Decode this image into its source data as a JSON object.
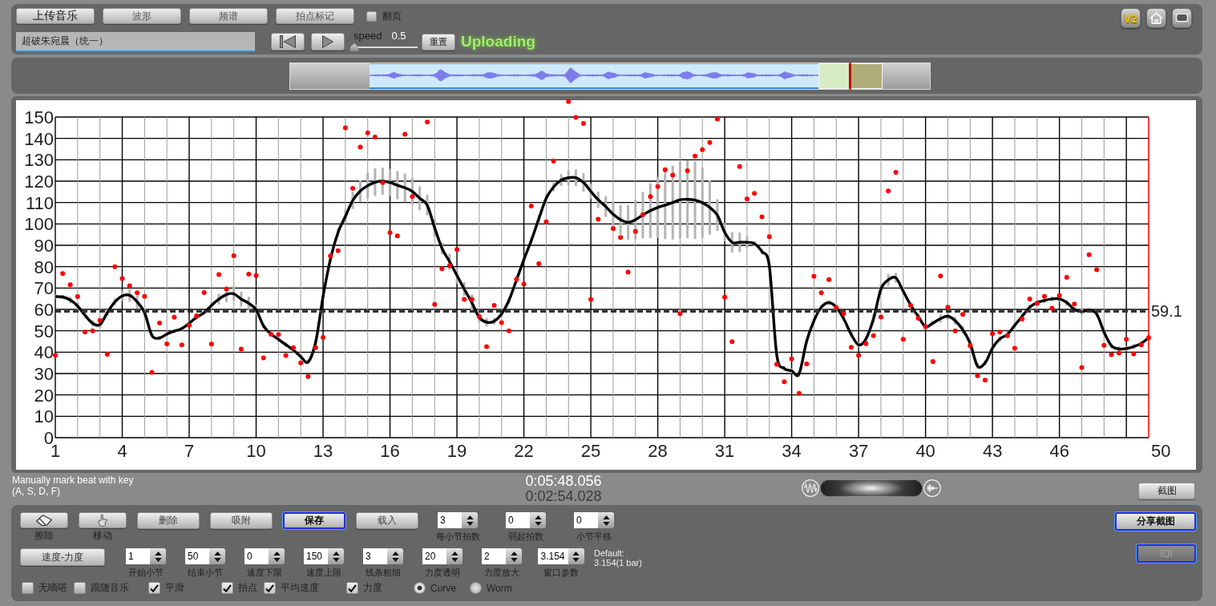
{
  "toolbar": {
    "buttons": [
      {
        "label": "上传音乐",
        "kind": "primary"
      },
      {
        "label": "波形",
        "kind": "view"
      },
      {
        "label": "频谱",
        "kind": "view"
      },
      {
        "label": "拍点标记",
        "kind": "view"
      }
    ],
    "page_turn": {
      "label": "翻页",
      "checked": false
    },
    "version_badge": "V2"
  },
  "player": {
    "track_title": "超破朱宛晨（统一）",
    "speed": {
      "label": "speed",
      "value": "0.5",
      "level": 0
    },
    "reset_button": "重置",
    "status": "Uploading"
  },
  "chart": {
    "chart_data": {
      "type": "scatter",
      "x": [
        1,
        1.33,
        1.67,
        2,
        2.33,
        2.67,
        3,
        3.33,
        3.67,
        4,
        4.33,
        4.67,
        5,
        5.33,
        5.67,
        6,
        6.33,
        6.67,
        7,
        7.33,
        7.67,
        8,
        8.33,
        8.67,
        9,
        9.33,
        9.67,
        10,
        10.33,
        10.67,
        11,
        11.33,
        11.67,
        12,
        12.33,
        12.67,
        13,
        13.33,
        13.67,
        14,
        14.33,
        14.67,
        15,
        15.33,
        15.67,
        16,
        16.33,
        16.67,
        17,
        17.33,
        17.67,
        18,
        18.33,
        18.67,
        19,
        19.33,
        19.67,
        20,
        20.33,
        20.67,
        21,
        21.33,
        21.67,
        22,
        22.33,
        22.67,
        23,
        23.33,
        23.67,
        24,
        24.33,
        24.67,
        25,
        25.33,
        25.67,
        26,
        26.33,
        26.67,
        27,
        27.33,
        27.67,
        28,
        28.33,
        28.67,
        29,
        29.33,
        29.67,
        30,
        30.33,
        30.67,
        31,
        31.33,
        31.67,
        32,
        32.33,
        32.67,
        33,
        33.33,
        33.67,
        34,
        34.33,
        34.67,
        35,
        35.33,
        35.67,
        36,
        36.33,
        36.67,
        37,
        37.33,
        37.67,
        38,
        38.33,
        38.67,
        39,
        39.33,
        39.67,
        40,
        40.33,
        40.67,
        41,
        41.33,
        41.67,
        42,
        42.33,
        42.67,
        43,
        43.33,
        43.67,
        44,
        44.33,
        44.67,
        45,
        45.33,
        45.67,
        46,
        46.33,
        46.67,
        47,
        47.33,
        47.67,
        48,
        48.33,
        48.67,
        49,
        49.33,
        49.67,
        50
      ],
      "series": [
        {
          "type": "scatter",
          "color": "#ff0000",
          "values": [
            38.5,
            76.8,
            71.5,
            66,
            49.4,
            50,
            54.8,
            39,
            80,
            74.4,
            71.1,
            67.8,
            66.1,
            30.6,
            53.6,
            43.9,
            56.3,
            43.4,
            52.6,
            57,
            67.9,
            43.8,
            76.3,
            69.6,
            85.1,
            41.4,
            76.5,
            75.8,
            37.3,
            48.4,
            48.3,
            38.4,
            42.1,
            35,
            28.6,
            42.1,
            46.9,
            85,
            87.5,
            144.9,
            116.6,
            135.9,
            142.6,
            140.6,
            119.3,
            95.9,
            94.4,
            141.9,
            112.8,
            null,
            147.7,
            62.3,
            79,
            80.4,
            88,
            64.7,
            64.7,
            56.6,
            42.6,
            61.9,
            53.8,
            50,
            74.2,
            71.8,
            108.4,
            81.4,
            101,
            129.4,
            null,
            157.2,
            149.8,
            147,
            64.7,
            102.2,
            null,
            97.8,
            93.7,
            77.4,
            96.5,
            104.3,
            112.8,
            117.5,
            125.3,
            122.8,
            58,
            124.9,
            131.7,
            134.7,
            138.1,
            149.1,
            65.7,
            44.9,
            126.8,
            111.7,
            114.3,
            103.3,
            94,
            34.3,
            26.2,
            36.8,
            20.7,
            34.5,
            75.5,
            67.8,
            74,
            60.8,
            58,
            42.3,
            38.5,
            44,
            47.7,
            56.4,
            115.4,
            124.1,
            46,
            61.9,
            55.9,
            51.9,
            35.6,
            75.7,
            61,
            50,
            57.7,
            43,
            29,
            26.9,
            48.7,
            49.4,
            47.7,
            41.8,
            55.5,
            64.9,
            62.8,
            66.1,
            60.6,
            66.5,
            75,
            62.5,
            32.8,
            85.6,
            78.6,
            43.2,
            38.8,
            39.6,
            46,
            39.2,
            43.4,
            46.8
          ]
        },
        {
          "type": "line",
          "color": "#000000",
          "values": [
            66,
            65.8,
            64.4,
            61.6,
            57.3,
            53.5,
            52.9,
            58.5,
            63.5,
            66.3,
            66.6,
            63.5,
            58.5,
            47.9,
            46.6,
            48.5,
            49.8,
            51,
            53.5,
            56.3,
            58.5,
            61.9,
            64.8,
            67,
            67.3,
            64.8,
            62.9,
            59.8,
            52.3,
            48.5,
            46,
            43.5,
            41,
            37.9,
            35.4,
            44.8,
            66,
            83.5,
            96,
            103.5,
            111,
            115.4,
            117.9,
            119.5,
            120,
            119.4,
            118.1,
            116.9,
            115.2,
            112,
            108.8,
            98.2,
            88.6,
            82.3,
            75.9,
            69.5,
            63.2,
            56.2,
            54,
            54.5,
            57.9,
            64.2,
            73.8,
            83.3,
            92.2,
            102.4,
            112,
            117.3,
            120.5,
            121.6,
            121.6,
            119.4,
            115.2,
            111.3,
            108.1,
            104.5,
            102,
            100.7,
            102,
            104.1,
            106.2,
            107.7,
            108.8,
            110,
            111.3,
            111.5,
            111.1,
            109.9,
            107.7,
            104.1,
            96.1,
            91.4,
            91.4,
            91.4,
            90.8,
            87,
            80.2,
            38.8,
            32.4,
            31.3,
            29.8,
            45.1,
            54.7,
            61,
            63.2,
            61,
            55.7,
            48.3,
            43.4,
            46.2,
            55.7,
            69.5,
            73.8,
            74.8,
            68.5,
            62.1,
            56.8,
            51.9,
            53.6,
            55.7,
            56.8,
            54.7,
            50.5,
            44.1,
            33.5,
            35,
            41.9,
            46.2,
            48.3,
            52.6,
            56.8,
            61,
            63.2,
            64.2,
            64.9,
            64.9,
            63.2,
            60,
            58.9,
            59.6,
            57.9,
            49.4,
            43,
            41.5,
            41.7,
            42.6,
            44.1,
            46.8
          ],
          "errors": [
            1,
            1,
            1.5,
            1.5,
            1.5,
            1.5,
            1.5,
            1.5,
            1.5,
            2.5,
            3,
            3,
            2,
            1,
            1,
            1,
            1,
            1,
            1,
            1,
            1,
            1.5,
            2.5,
            3.5,
            3.5,
            3.5,
            3,
            2.5,
            1,
            1,
            1,
            1,
            1,
            1,
            1,
            1,
            1,
            1.5,
            2,
            3,
            4,
            5,
            6,
            6.5,
            6.3,
            6.4,
            6.6,
            6.7,
            6.2,
            5.6,
            4.8,
            4.2,
            2.7,
            3.7,
            3.8,
            3.2,
            3.7,
            2.2,
            2,
            1.6,
            1.3,
            1.3,
            1.3,
            1.3,
            1.5,
            1.8,
            2,
            2,
            2.7,
            3.4,
            3.9,
            4.3,
            3.5,
            3.8,
            4.8,
            6,
            6.9,
            8.1,
            9.3,
            10.9,
            12.8,
            14.3,
            15.9,
            17.3,
            18,
            18.2,
            18.2,
            16.4,
            12.7,
            7.4,
            4.3,
            4.8,
            4.6,
            2.7,
            1.1,
            1.2,
            1.2,
            1.2,
            1.2,
            1.2,
            1.2,
            1.2,
            1.2,
            1.2,
            1.2,
            1.2,
            1.2,
            1.2,
            1.2,
            1.2,
            2,
            2.5,
            2.8,
            2.3,
            1.8,
            1.2,
            1.2,
            1.2,
            1.2,
            1.8,
            1.8,
            1.8,
            1.8,
            1.2,
            1.2,
            1.2,
            1.2,
            1.2,
            1.2,
            1.2,
            1.2,
            1.2,
            1.2,
            1.2,
            1.2,
            1.2,
            1.2,
            1.2,
            1.2,
            1.2,
            1.2,
            1.2,
            1.2,
            1.2,
            1.2,
            1.2,
            1.2,
            1.2
          ]
        }
      ],
      "ref_lines": [
        {
          "axis": "y",
          "value": 59.1,
          "label": "59.1"
        }
      ],
      "grid": true,
      "xlim": [
        1,
        50
      ],
      "ylim": [
        0,
        157.5
      ],
      "xticks": [
        1,
        4,
        7,
        10,
        13,
        16,
        19,
        22,
        25,
        28,
        31,
        34,
        37,
        40,
        43,
        46,
        50
      ],
      "yticks": [
        0,
        10,
        20,
        30,
        40,
        50,
        60,
        70,
        80,
        90,
        100,
        110,
        120,
        130,
        140,
        150
      ]
    }
  },
  "key_hint": "Manually mark beat with key\n(A, S, D, F)",
  "times": {
    "total": "0:05:48.056",
    "position": "0:02:54.028"
  },
  "balance_slider": {
    "level": 0.5
  },
  "screenshot_button": "截图",
  "controls": {
    "tool_buttons": [
      {
        "label": "擦除",
        "kind": "eraser"
      },
      {
        "label": "移动",
        "kind": "hand"
      }
    ],
    "action_buttons": [
      {
        "label": "删除",
        "highlighted": false
      },
      {
        "label": "吸附",
        "highlighted": false
      },
      {
        "label": "保存",
        "highlighted": true
      },
      {
        "label": "载入",
        "highlighted": false
      }
    ],
    "beat_fields": [
      {
        "value": "3",
        "label": "每小节拍数"
      },
      {
        "value": "0",
        "label": "弱起拍数"
      },
      {
        "value": "0",
        "label": "小节平移"
      }
    ],
    "mode_button": "速度-力度",
    "range_fields": [
      {
        "value": "1",
        "label": "开始小节"
      },
      {
        "value": "50",
        "label": "结束小节"
      },
      {
        "value": "0",
        "label": "速度下限"
      },
      {
        "value": "150",
        "label": "速度上限"
      },
      {
        "value": "3",
        "label": "线条粗细"
      },
      {
        "value": "20",
        "label": "力度透明"
      },
      {
        "value": "2",
        "label": "力度放大"
      },
      {
        "value": "3.154",
        "label": "窗口参数"
      }
    ],
    "default_note": "Default:\n3.154(1 bar)",
    "checkboxes": [
      {
        "label": "无嘀嗒",
        "checked": false
      },
      {
        "label": "跟随音乐",
        "checked": false
      },
      {
        "label": "平滑",
        "checked": true
      },
      {
        "label": "拍点",
        "checked": true
      },
      {
        "label": "平均速度",
        "checked": true
      },
      {
        "label": "力度",
        "checked": true
      }
    ],
    "display_mode": [
      {
        "label": "Curve",
        "selected": true
      },
      {
        "label": "Worm",
        "selected": false
      }
    ],
    "share_button": {
      "label": "分享截图",
      "highlighted": true,
      "disabled": false
    },
    "ioi_button": {
      "label": "IOI",
      "highlighted": true,
      "disabled": true
    }
  }
}
